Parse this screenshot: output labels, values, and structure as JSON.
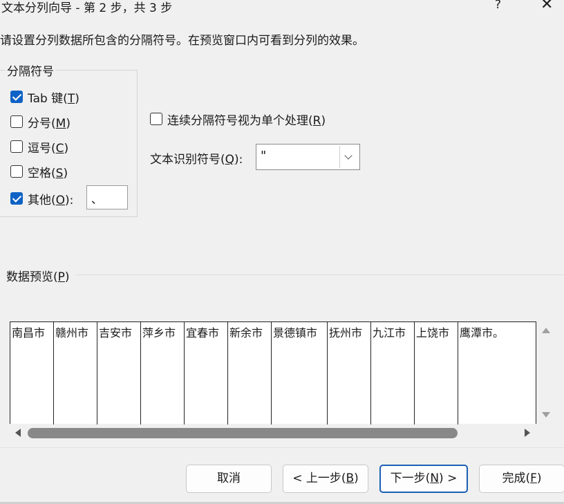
{
  "window": {
    "title": "文本分列向导 - 第 2 步，共 3 步",
    "help": "?",
    "close": "✕"
  },
  "instruction": "请设置分列数据所包含的分隔符号。在预览窗口内可看到分列的效果。",
  "delimiters": {
    "group_title": "分隔符号",
    "tab": {
      "label": "Tab 键(",
      "key": "T",
      "checked": true
    },
    "semicolon": {
      "label": "分号(",
      "key": "M",
      "checked": false
    },
    "comma": {
      "label": "逗号(",
      "key": "C",
      "checked": false
    },
    "space": {
      "label": "空格(",
      "key": "S",
      "checked": false
    },
    "other": {
      "label": "其他(",
      "key": "O",
      "suffix": "):",
      "checked": true,
      "value": "、"
    }
  },
  "options": {
    "consecutive": {
      "label": "连续分隔符号视为单个处理(",
      "key": "R",
      "checked": false
    },
    "qualifier": {
      "label": "文本识别符号(",
      "key": "Q",
      "suffix": "):",
      "value": "\""
    }
  },
  "preview": {
    "title": "数据预览(",
    "key": "P",
    "columns": [
      "南昌市",
      "赣州市",
      "吉安市",
      "萍乡市",
      "宜春市",
      "新余市",
      "景德镇市",
      "抚州市",
      "九江市",
      "上饶市",
      "鹰潭市。"
    ]
  },
  "buttons": {
    "cancel": "取消",
    "back": "< 上一步(",
    "back_key": "B",
    "next": "下一步(",
    "next_key": "N",
    "next_suffix": ") >",
    "finish": "完成(",
    "finish_key": "F"
  }
}
